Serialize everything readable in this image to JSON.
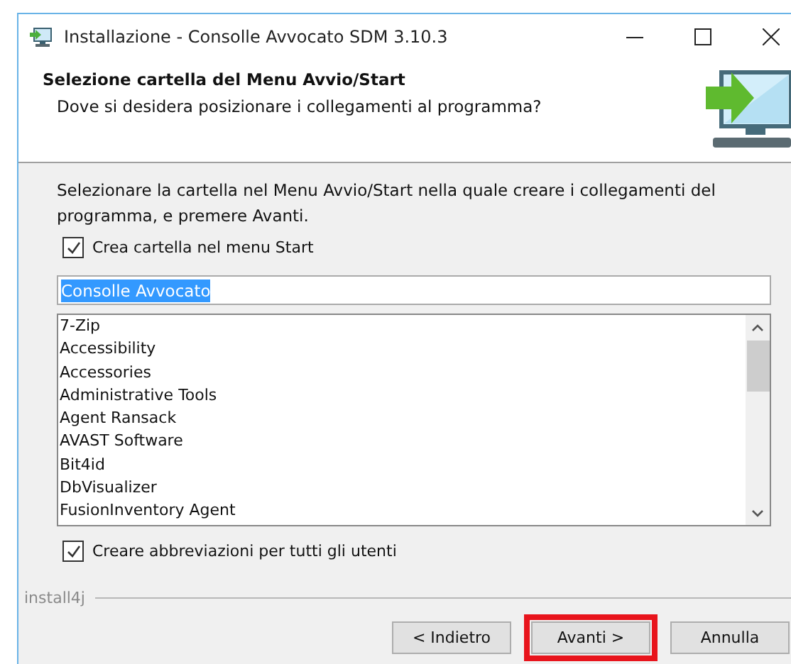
{
  "window": {
    "title": "Installazione - Consolle Avvocato SDM 3.10.3"
  },
  "header": {
    "title": "Selezione cartella del Menu Avvio/Start",
    "subtitle": "Dove si desidera posizionare i collegamenti al programma?"
  },
  "instructions": "Selezionare la cartella nel Menu Avvio/Start nella quale creare i collegamenti del programma, e premere Avanti.",
  "create_folder": {
    "label": "Crea cartella nel menu Start",
    "checked": true
  },
  "folder_field": {
    "value": "Consolle Avvocato",
    "selected": true
  },
  "folders": [
    "7-Zip",
    "Accessibility",
    "Accessories",
    "Administrative Tools",
    "Agent Ransack",
    "AVAST Software",
    "Bit4id",
    "DbVisualizer",
    "FusionInventory Agent"
  ],
  "all_users": {
    "label": "Creare abbreviazioni per tutti gli utenti",
    "checked": true
  },
  "brand": "install4j",
  "buttons": [
    {
      "label": "< Indietro",
      "highlighted": false
    },
    {
      "label": "Avanti >",
      "highlighted": true
    },
    {
      "label": "Annulla",
      "highlighted": false
    }
  ]
}
